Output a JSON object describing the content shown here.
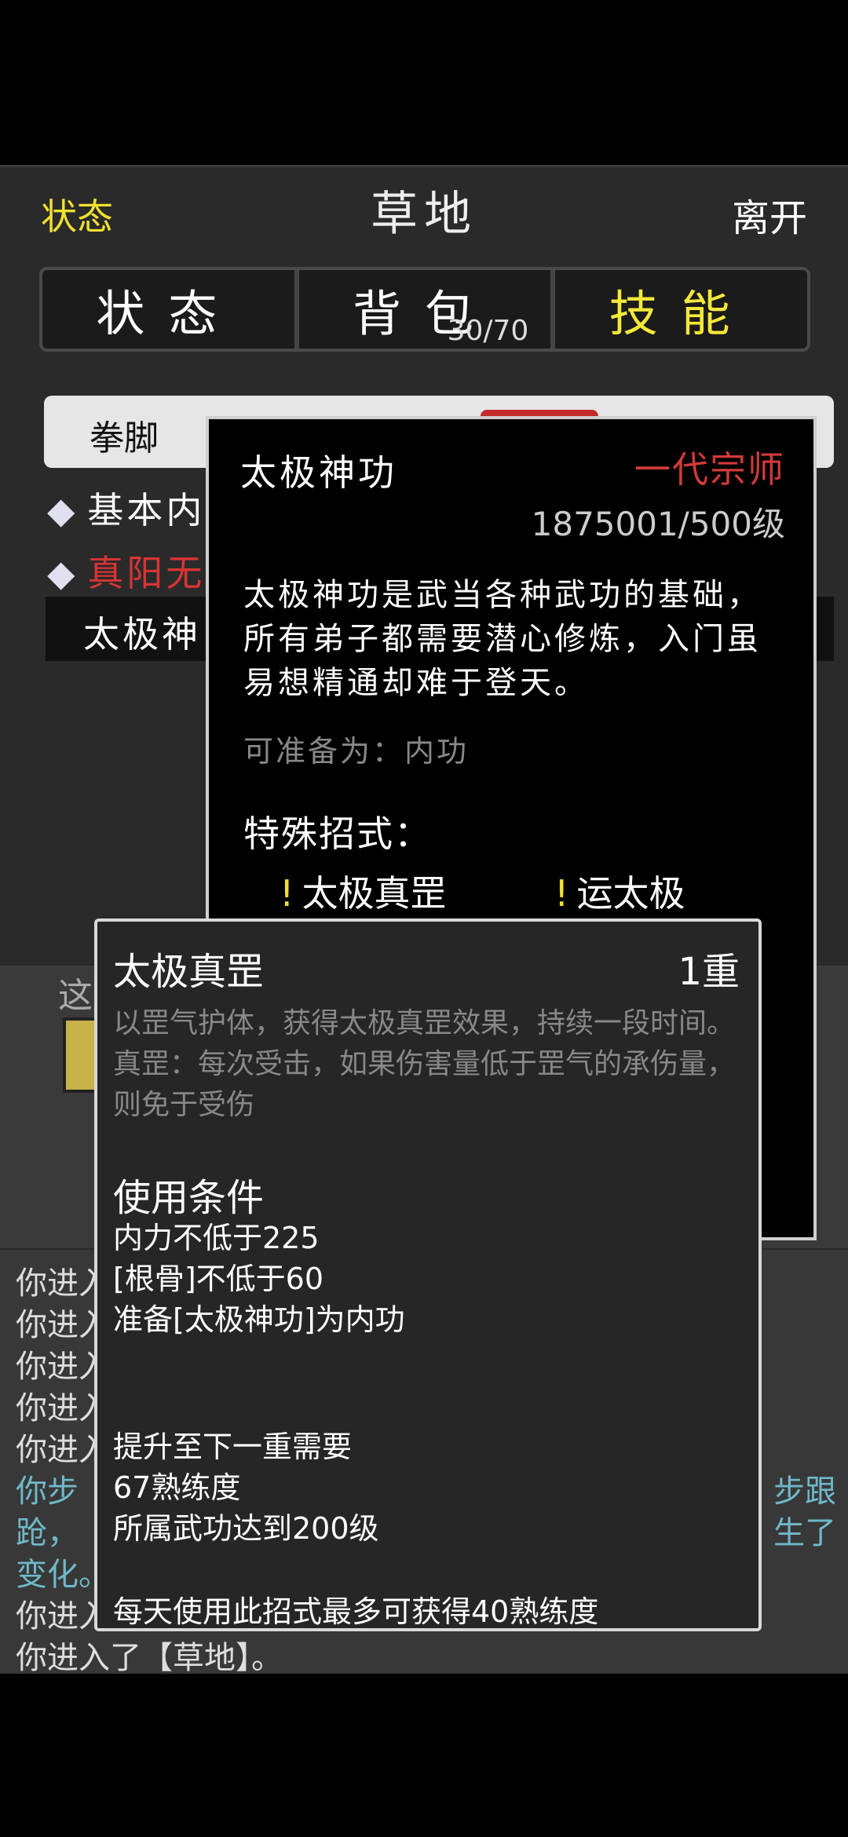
{
  "header": {
    "left": "状态",
    "title": "草地",
    "right": "离开"
  },
  "tabs": [
    {
      "label": "状态"
    },
    {
      "label": "背包",
      "count": "30/70"
    },
    {
      "label": "技能"
    }
  ],
  "categories": {
    "first": "拳脚"
  },
  "skills": {
    "row1": "基本内",
    "row2": "真阳无",
    "row3": "太极神"
  },
  "map": {
    "label": "这"
  },
  "log": [
    "你进入",
    "你进入",
    "你进入",
    "你进入",
    "你进入",
    "你步",
    "跄，",
    "变化。",
    "你进入",
    "你进入了【草地】。"
  ],
  "log_right": {
    "line1": "步跟",
    "line2": "生了"
  },
  "skill_panel": {
    "name": "太极神功",
    "rank": "一代宗师",
    "level": "1875001/500级",
    "description": "太极神功是武当各种武功的基础，所有弟子都需要潜心修炼，入门虽易想精通却难于登天。",
    "prep": "可准备为：内功",
    "special_title": "特殊招式：",
    "moves": [
      "太极真罡",
      "运太极"
    ]
  },
  "move_panel": {
    "name": "太极真罡",
    "level": "1重",
    "description": "以罡气护体，获得太极真罡效果，持续一段时间。真罡：每次受击，如果伤害量低于罡气的承伤量，则免于受伤",
    "cond_title": "使用条件",
    "conditions": [
      "内力不低于225",
      "[根骨]不低于60",
      "准备[太极神功]为内功"
    ],
    "upgrade_title": "提升至下一重需要",
    "upgrade": [
      "67熟练度",
      "所属武功达到200级"
    ],
    "daily": "每天使用此招式最多可获得40熟练度"
  },
  "colors": {
    "accent_yellow": "#f4e83a",
    "rank_red": "#d23a3a",
    "log_cyan": "#6fb8c9"
  }
}
